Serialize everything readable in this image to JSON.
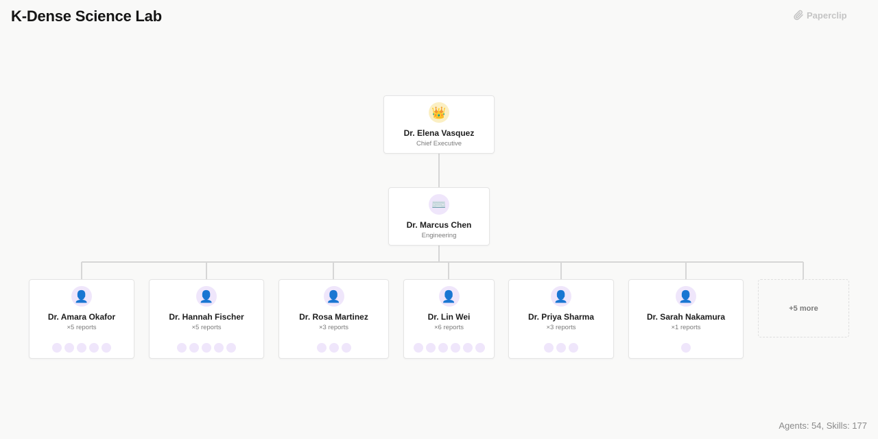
{
  "header": {
    "title": "K-Dense Science Lab"
  },
  "brand": {
    "label": "Paperclip",
    "icon": "paperclip-icon"
  },
  "footer": {
    "stats": "Agents: 54, Skills: 177"
  },
  "org": {
    "root": {
      "name": "Dr. Elena Vasquez",
      "role": "Chief Executive",
      "icon": "crown-icon"
    },
    "manager": {
      "name": "Dr. Marcus Chen",
      "role": "Engineering",
      "icon": "keyboard-icon"
    },
    "reports": [
      {
        "name": "Dr. Amara Okafor",
        "reports_label": "×5 reports",
        "report_count": 5,
        "icon": "person-icon"
      },
      {
        "name": "Dr. Hannah Fischer",
        "reports_label": "×5 reports",
        "report_count": 5,
        "icon": "person-icon"
      },
      {
        "name": "Dr. Rosa Martinez",
        "reports_label": "×3 reports",
        "report_count": 3,
        "icon": "person-icon"
      },
      {
        "name": "Dr. Lin Wei",
        "reports_label": "×6 reports",
        "report_count": 6,
        "icon": "person-icon"
      },
      {
        "name": "Dr. Priya Sharma",
        "reports_label": "×3 reports",
        "report_count": 3,
        "icon": "person-icon"
      },
      {
        "name": "Dr. Sarah Nakamura",
        "reports_label": "×1 reports",
        "report_count": 1,
        "icon": "person-icon"
      }
    ],
    "more_label": "+5 more"
  },
  "colors": {
    "background": "#f9f9f8",
    "connector": "#d6d6d6",
    "avatar_lavender": "#efe6fb",
    "avatar_gold": "#fbefc3",
    "person_icon": "#2f5f9a"
  }
}
